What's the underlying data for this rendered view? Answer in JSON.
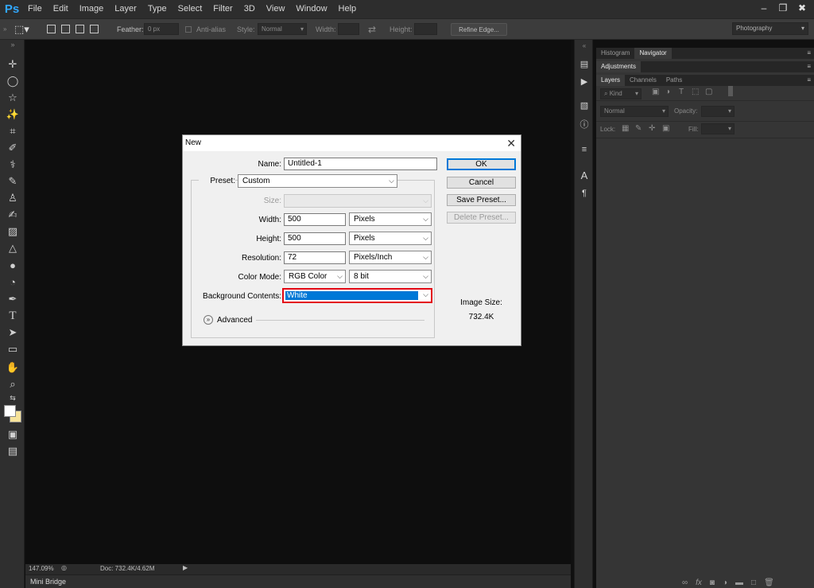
{
  "app": {
    "logo": "Ps"
  },
  "menu": [
    "File",
    "Edit",
    "Image",
    "Layer",
    "Type",
    "Select",
    "Filter",
    "3D",
    "View",
    "Window",
    "Help"
  ],
  "window_controls": [
    "minimize-icon",
    "restore-icon",
    "close-icon"
  ],
  "options": {
    "feather_label": "Feather:",
    "feather_value": "0 px",
    "antialias_label": "Anti-alias",
    "style_label": "Style:",
    "style_value": "Normal",
    "width_label": "Width:",
    "height_label": "Height:",
    "refine_edge": "Refine Edge...",
    "workspace": "Photography"
  },
  "status": {
    "zoom": "147.09%",
    "doc": "Doc: 732.4K/4.62M"
  },
  "mini_bridge": "Mini Bridge",
  "panels": {
    "top_tabs": [
      "Histogram",
      "Navigator"
    ],
    "adjustments": "Adjustments",
    "layer_tabs": [
      "Layers",
      "Channels",
      "Paths"
    ],
    "kind_label": "Kind",
    "blend_mode": "Normal",
    "opacity_label": "Opacity:",
    "lock_label": "Lock:",
    "fill_label": "Fill:"
  },
  "dialog": {
    "title": "New",
    "name_label": "Name:",
    "name_value": "Untitled-1",
    "preset_label": "Preset:",
    "preset_value": "Custom",
    "size_label": "Size:",
    "width_label": "Width:",
    "width_value": "500",
    "width_unit": "Pixels",
    "height_label": "Height:",
    "height_value": "500",
    "height_unit": "Pixels",
    "resolution_label": "Resolution:",
    "resolution_value": "72",
    "resolution_unit": "Pixels/Inch",
    "color_mode_label": "Color Mode:",
    "color_mode_value": "RGB Color",
    "bit_depth": "8 bit",
    "bg_label": "Background Contents:",
    "bg_value": "White",
    "advanced_label": "Advanced",
    "ok": "OK",
    "cancel": "Cancel",
    "save_preset": "Save Preset...",
    "delete_preset": "Delete Preset...",
    "image_size_label": "Image Size:",
    "image_size_value": "732.4K"
  },
  "colors": {
    "highlight": "#0078d7",
    "annotation": "#e30613",
    "foreground": "#ffffff",
    "background": "#f7e39b"
  }
}
